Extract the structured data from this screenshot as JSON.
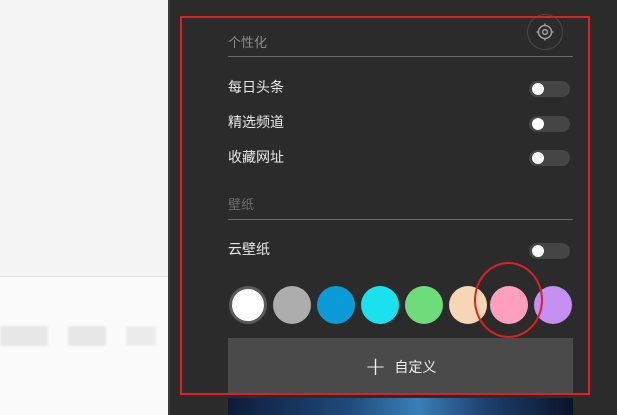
{
  "sections": {
    "personalization": {
      "title": "个性化",
      "items": [
        {
          "label": "每日头条",
          "enabled": false
        },
        {
          "label": "精选频道",
          "enabled": false
        },
        {
          "label": "收藏网址",
          "enabled": false
        }
      ]
    },
    "wallpaper": {
      "title": "壁纸",
      "cloud_wallpaper": {
        "label": "云壁纸",
        "enabled": false
      },
      "colors": [
        "#ffffff",
        "#adadad",
        "#0b9bd6",
        "#19e2ee",
        "#6edc7a",
        "#f6d7b5",
        "#ff9fc0",
        "#c390f2"
      ],
      "selected_color": "#ffffff",
      "custom_button": {
        "label": "自定义"
      }
    }
  },
  "icons": {
    "settings": "settings-icon",
    "plus": "plus-icon"
  },
  "annotation_colors": {
    "highlight": "#e02020"
  }
}
